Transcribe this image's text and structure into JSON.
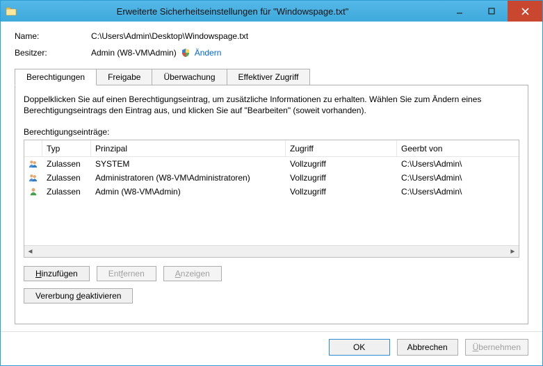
{
  "window": {
    "title": "Erweiterte Sicherheitseinstellungen für \"Windowspage.txt\""
  },
  "fields": {
    "name_label": "Name:",
    "name_value": "C:\\Users\\Admin\\Desktop\\Windowspage.txt",
    "owner_label": "Besitzer:",
    "owner_value": "Admin (W8-VM\\Admin)",
    "change_link": "Ändern"
  },
  "tabs": {
    "perm": "Berechtigungen",
    "share": "Freigabe",
    "audit": "Überwachung",
    "effective": "Effektiver Zugriff"
  },
  "hint": "Doppelklicken Sie auf einen Berechtigungseintrag, um zusätzliche Informationen zu erhalten. Wählen Sie zum Ändern eines Berechtigungseintrags den Eintrag aus, und klicken Sie auf \"Bearbeiten\" (soweit vorhanden).",
  "entries_label": "Berechtigungseinträge:",
  "columns": {
    "type": "Typ",
    "principal": "Prinzipal",
    "access": "Zugriff",
    "inherited": "Geerbt von"
  },
  "rows": [
    {
      "icon": "group",
      "type": "Zulassen",
      "principal": "SYSTEM",
      "access": "Vollzugriff",
      "inherited": "C:\\Users\\Admin\\"
    },
    {
      "icon": "group",
      "type": "Zulassen",
      "principal": "Administratoren (W8-VM\\Administratoren)",
      "access": "Vollzugriff",
      "inherited": "C:\\Users\\Admin\\"
    },
    {
      "icon": "user",
      "type": "Zulassen",
      "principal": "Admin (W8-VM\\Admin)",
      "access": "Vollzugriff",
      "inherited": "C:\\Users\\Admin\\"
    }
  ],
  "buttons": {
    "add": "Hinzufügen",
    "remove": "Entfernen",
    "view": "Anzeigen",
    "disable_inherit": "Vererbung deaktivieren",
    "ok": "OK",
    "cancel": "Abbrechen",
    "apply": "Übernehmen"
  }
}
